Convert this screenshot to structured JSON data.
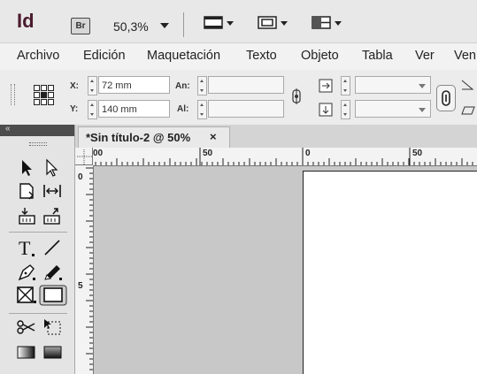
{
  "app": {
    "logo_text": "Id",
    "bridge_badge": "Br",
    "zoom_value": "50,3%",
    "colors": {
      "logo": "#4b1b2f",
      "ruler": "#f3f3f3",
      "pasteboard": "#c8c8c8",
      "page": "#ffffff"
    }
  },
  "toolbar_icons": [
    "screen-mode-icon",
    "view-options-icon",
    "arrange-documents-icon"
  ],
  "menu": {
    "items": [
      "Archivo",
      "Edición",
      "Maquetación",
      "Texto",
      "Objeto",
      "Tabla",
      "Ver",
      "Ven"
    ]
  },
  "control_panel": {
    "x_label": "X:",
    "x_value": "72 mm",
    "y_label": "Y:",
    "y_value": "140 mm",
    "width_label": "An:",
    "width_value": "",
    "height_label": "Al:",
    "height_value": "",
    "scale_x_value": "",
    "scale_y_value": ""
  },
  "tools_panel": {
    "collapse_glyph": "«"
  },
  "document": {
    "tab_title": "*Sin título-2 @ 50%",
    "close_glyph": "×"
  },
  "rulers": {
    "top_labels": [
      "00",
      "50",
      "0",
      "50"
    ],
    "left_labels": [
      "0",
      "5"
    ]
  }
}
